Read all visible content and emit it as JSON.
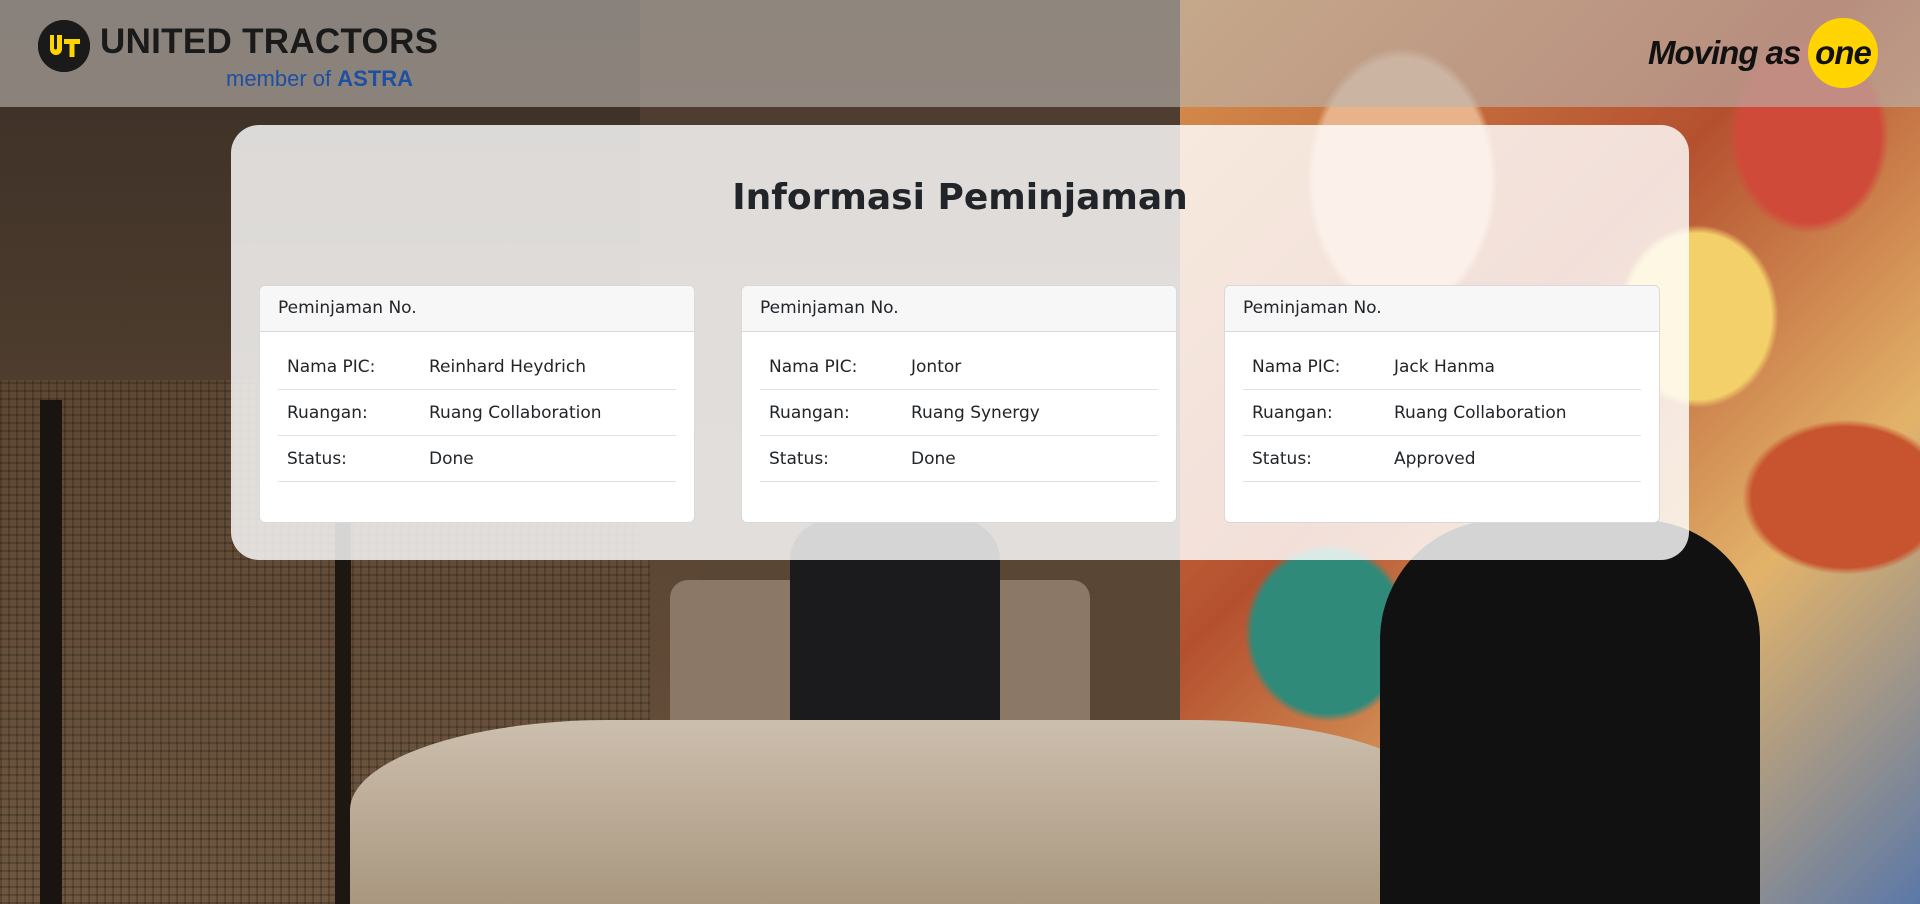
{
  "header": {
    "brand_name": "UNITED TRACTORS",
    "brand_sub_prefix": "member of ",
    "brand_sub_strong": "ASTRA",
    "tagline_prefix": "Moving as ",
    "tagline_highlight": "one",
    "colors": {
      "brand_blue": "#1e4fa0",
      "tagline_yellow": "#ffd400"
    }
  },
  "main": {
    "title": "Informasi Peminjaman",
    "cards": [
      {
        "header": "Peminjaman No.",
        "rows": [
          {
            "label": "Nama PIC:",
            "value": "Reinhard Heydrich"
          },
          {
            "label": "Ruangan:",
            "value": "Ruang Collaboration"
          },
          {
            "label": "Status:",
            "value": "Done"
          }
        ]
      },
      {
        "header": "Peminjaman No.",
        "rows": [
          {
            "label": "Nama PIC:",
            "value": "Jontor"
          },
          {
            "label": "Ruangan:",
            "value": "Ruang Synergy"
          },
          {
            "label": "Status:",
            "value": "Done"
          }
        ]
      },
      {
        "header": "Peminjaman No.",
        "rows": [
          {
            "label": "Nama PIC:",
            "value": "Jack Hanma"
          },
          {
            "label": "Ruangan:",
            "value": "Ruang Collaboration"
          },
          {
            "label": "Status:",
            "value": "Approved"
          }
        ]
      }
    ]
  }
}
